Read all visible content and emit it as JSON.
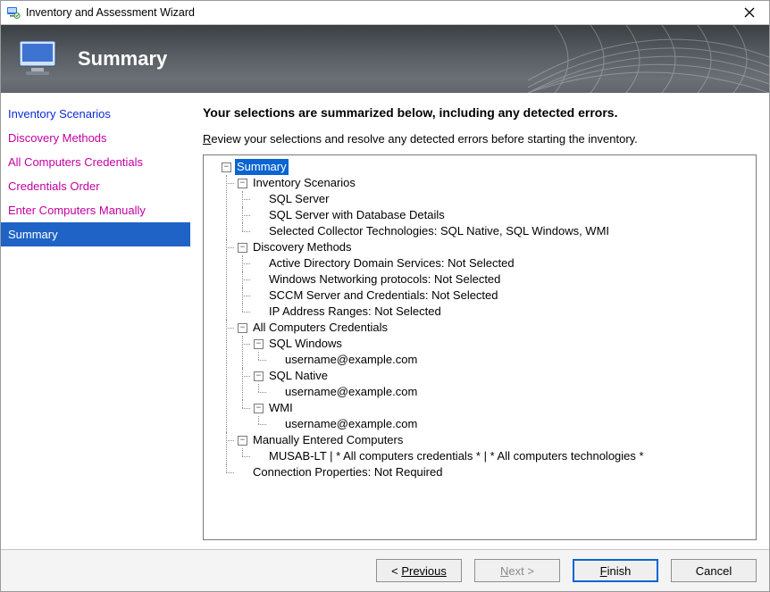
{
  "window": {
    "title": "Inventory and Assessment Wizard"
  },
  "banner": {
    "title": "Summary"
  },
  "sidebar": {
    "items": [
      {
        "label": "Inventory Scenarios",
        "state": "past"
      },
      {
        "label": "Discovery Methods",
        "state": "visited"
      },
      {
        "label": "All Computers Credentials",
        "state": "visited"
      },
      {
        "label": "Credentials Order",
        "state": "visited"
      },
      {
        "label": "Enter Computers Manually",
        "state": "visited"
      },
      {
        "label": "Summary",
        "state": "active"
      }
    ]
  },
  "main": {
    "heading": "Your selections are summarized below, including any detected errors.",
    "sub_prefix": "R",
    "sub_rest": "eview your selections and resolve any detected errors before starting the inventory."
  },
  "tree": {
    "root": "Summary",
    "inventory_scenarios": {
      "label": "Inventory Scenarios",
      "items": [
        "SQL Server",
        "SQL Server with Database Details",
        "Selected Collector Technologies: SQL Native, SQL Windows, WMI"
      ]
    },
    "discovery_methods": {
      "label": "Discovery Methods",
      "items": [
        "Active Directory Domain Services: Not Selected",
        "Windows Networking protocols: Not Selected",
        "SCCM Server and Credentials: Not Selected",
        "IP Address Ranges: Not Selected"
      ]
    },
    "all_creds": {
      "label": "All Computers Credentials",
      "groups": [
        {
          "name": "SQL Windows",
          "entries": [
            "username@example.com"
          ]
        },
        {
          "name": "SQL Native",
          "entries": [
            "username@example.com"
          ]
        },
        {
          "name": "WMI",
          "entries": [
            "username@example.com"
          ]
        }
      ]
    },
    "manual": {
      "label": "Manually Entered Computers",
      "items": [
        "MUSAB-LT | * All computers credentials * | * All computers technologies *"
      ]
    },
    "connection_properties": "Connection Properties: Not Required"
  },
  "buttons": {
    "previous": "Previous",
    "next": "Next >",
    "finish": "Finish",
    "cancel": "Cancel"
  }
}
